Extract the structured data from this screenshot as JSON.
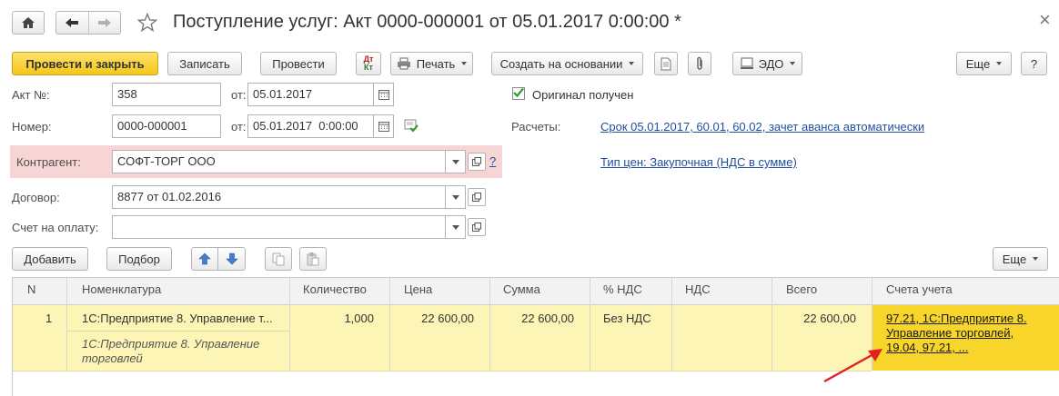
{
  "window": {
    "title": "Поступление услуг: Акт 0000-000001 от 05.01.2017 0:00:00 *",
    "close_glyph": "×"
  },
  "toolbar": {
    "post_close": "Провести и закрыть",
    "save": "Записать",
    "post": "Провести",
    "print": "Печать",
    "create_based_on": "Создать на основании",
    "edo": "ЭДО",
    "more": "Еще",
    "help": "?",
    "dtkt_top": "Дт",
    "dtkt_bottom": "Кт"
  },
  "form": {
    "act_no_label": "Акт №:",
    "act_no_value": "358",
    "from_label_1": "от:",
    "act_date_value": "05.01.2017",
    "number_label": "Номер:",
    "number_value": "0000-000001",
    "from_label_2": "от:",
    "number_date_value": "05.01.2017  0:00:00",
    "contractor_label": "Контрагент:",
    "contractor_value": "СОФТ-ТОРГ ООО",
    "contractor_help": "?",
    "contract_label": "Договор:",
    "contract_value": "8877 от 01.02.2016",
    "invoice_label": "Счет на оплату:",
    "invoice_value": "",
    "original_received_label": "Оригинал получен",
    "original_received_checked": true,
    "settlements_label": "Расчеты:",
    "settlements_link": "Срок 05.01.2017, 60.01, 60.02, зачет аванса автоматически",
    "price_type_link": "Тип цен: Закупочная (НДС в сумме)"
  },
  "table_toolbar": {
    "add": "Добавить",
    "select": "Подбор",
    "more": "Еще"
  },
  "table": {
    "columns": [
      "N",
      "Номенклатура",
      "Количество",
      "Цена",
      "Сумма",
      "% НДС",
      "НДС",
      "Всего",
      "Счета учета"
    ],
    "rows": [
      {
        "n": "1",
        "nomenclature": "1С:Предприятие 8. Управление т...",
        "nomenclature_content": "1С:Предприятие 8. Управление торговлей",
        "quantity": "1,000",
        "price": "22 600,00",
        "sum": "22 600,00",
        "vat_rate": "Без НДС",
        "vat": "",
        "total": "22 600,00",
        "accounts": "97.21, 1С:Предприятие 8. Управление торговлей, 19.04, 97.21, ..."
      }
    ]
  },
  "colors": {
    "primary_button": "#f5c718",
    "row_highlight": "#fdf5b5",
    "accounts_cell": "#f7d52a",
    "link": "#1f4e9e",
    "contractor_bg": "#f7d5d5",
    "arrow": "#e31f1f"
  }
}
